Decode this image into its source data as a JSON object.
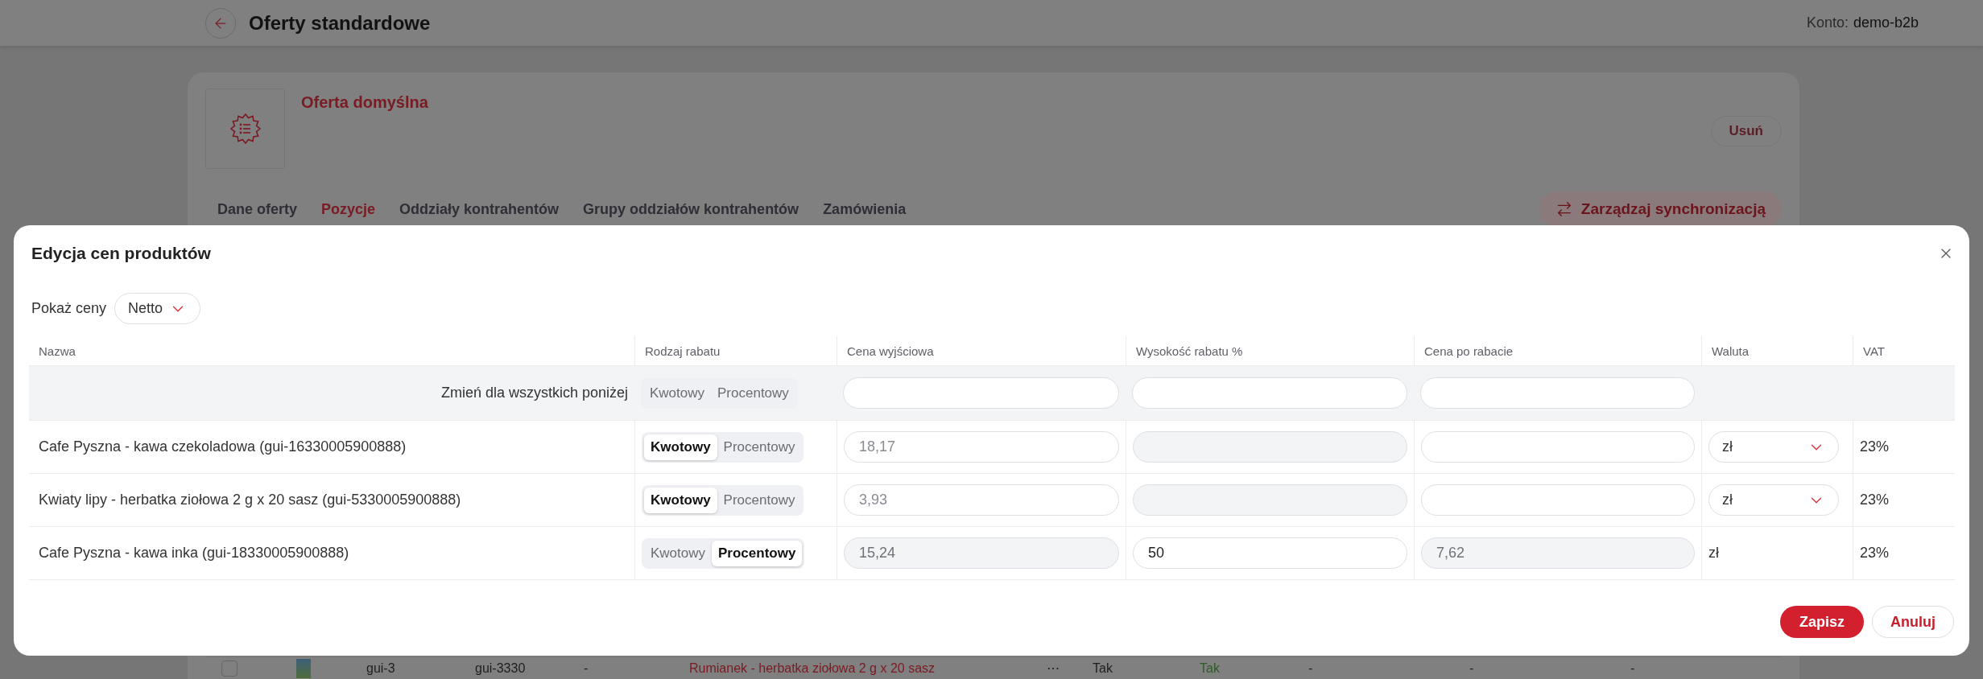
{
  "header": {
    "title": "Oferty standardowe",
    "account_label": "Konto:",
    "account": "demo-b2b"
  },
  "offer": {
    "name": "Oferta domyślna",
    "delete_button": "Usuń",
    "sync_button": "Zarządzaj synchronizacją",
    "tabs": [
      {
        "label": "Dane oferty",
        "selected": false
      },
      {
        "label": "Pozycje",
        "selected": true
      },
      {
        "label": "Oddziały kontrahentów",
        "selected": false
      },
      {
        "label": "Grupy oddziałów kontrahentów",
        "selected": false
      },
      {
        "label": "Zamówienia",
        "selected": false
      }
    ]
  },
  "background_row": {
    "checked": false,
    "cells": [
      "gui-3",
      "gui-3330",
      "-",
      "Rumianek - herbatka ziołowa 2 g x 20 sasz",
      "⋯",
      "Tak",
      "Tak",
      "-",
      "-",
      "-"
    ]
  },
  "modal": {
    "title": "Edycja cen produktów",
    "price_filter": {
      "label": "Pokaż ceny",
      "value": "Netto"
    },
    "columns": [
      "Nazwa",
      "Rodzaj rabatu",
      "Cena wyjściowa",
      "Wysokość rabatu %",
      "Cena po rabacie",
      "Waluta",
      "VAT"
    ],
    "bulk_row": {
      "label": "Zmień dla wszystkich poniżej",
      "discount_types": [
        {
          "label": "Kwotowy",
          "selected": false
        },
        {
          "label": "Procentowy",
          "selected": false
        }
      ]
    },
    "rows": [
      {
        "name": "Cafe Pyszna - kawa czekoladowa (gui-16330005900888)",
        "discount_types": [
          {
            "label": "Kwotowy",
            "selected": true
          },
          {
            "label": "Procentowy",
            "selected": false
          }
        ],
        "base_price": {
          "placeholder": "18,17",
          "disabled": false
        },
        "discount_percent": {
          "disabled": true
        },
        "final_price": {
          "disabled": false
        },
        "currency": {
          "kind": "select",
          "value": "zł"
        },
        "vat": "23%"
      },
      {
        "name": "Kwiaty lipy - herbatka ziołowa 2 g x 20 sasz (gui-5330005900888)",
        "discount_types": [
          {
            "label": "Kwotowy",
            "selected": true
          },
          {
            "label": "Procentowy",
            "selected": false
          }
        ],
        "base_price": {
          "placeholder": "3,93",
          "disabled": false
        },
        "discount_percent": {
          "disabled": true
        },
        "final_price": {
          "disabled": false
        },
        "currency": {
          "kind": "select",
          "value": "zł"
        },
        "vat": "23%"
      },
      {
        "name": "Cafe Pyszna - kawa inka (gui-18330005900888)",
        "discount_types": [
          {
            "label": "Kwotowy",
            "selected": false
          },
          {
            "label": "Procentowy",
            "selected": true
          }
        ],
        "base_price": {
          "value": "15,24",
          "disabled": true
        },
        "discount_percent": {
          "value": "50",
          "disabled": false
        },
        "final_price": {
          "value": "7,62",
          "disabled": true
        },
        "currency": {
          "kind": "text",
          "value": "zł"
        },
        "vat": "23%"
      }
    ],
    "save_button": "Zapisz",
    "cancel_button": "Anuluj"
  }
}
